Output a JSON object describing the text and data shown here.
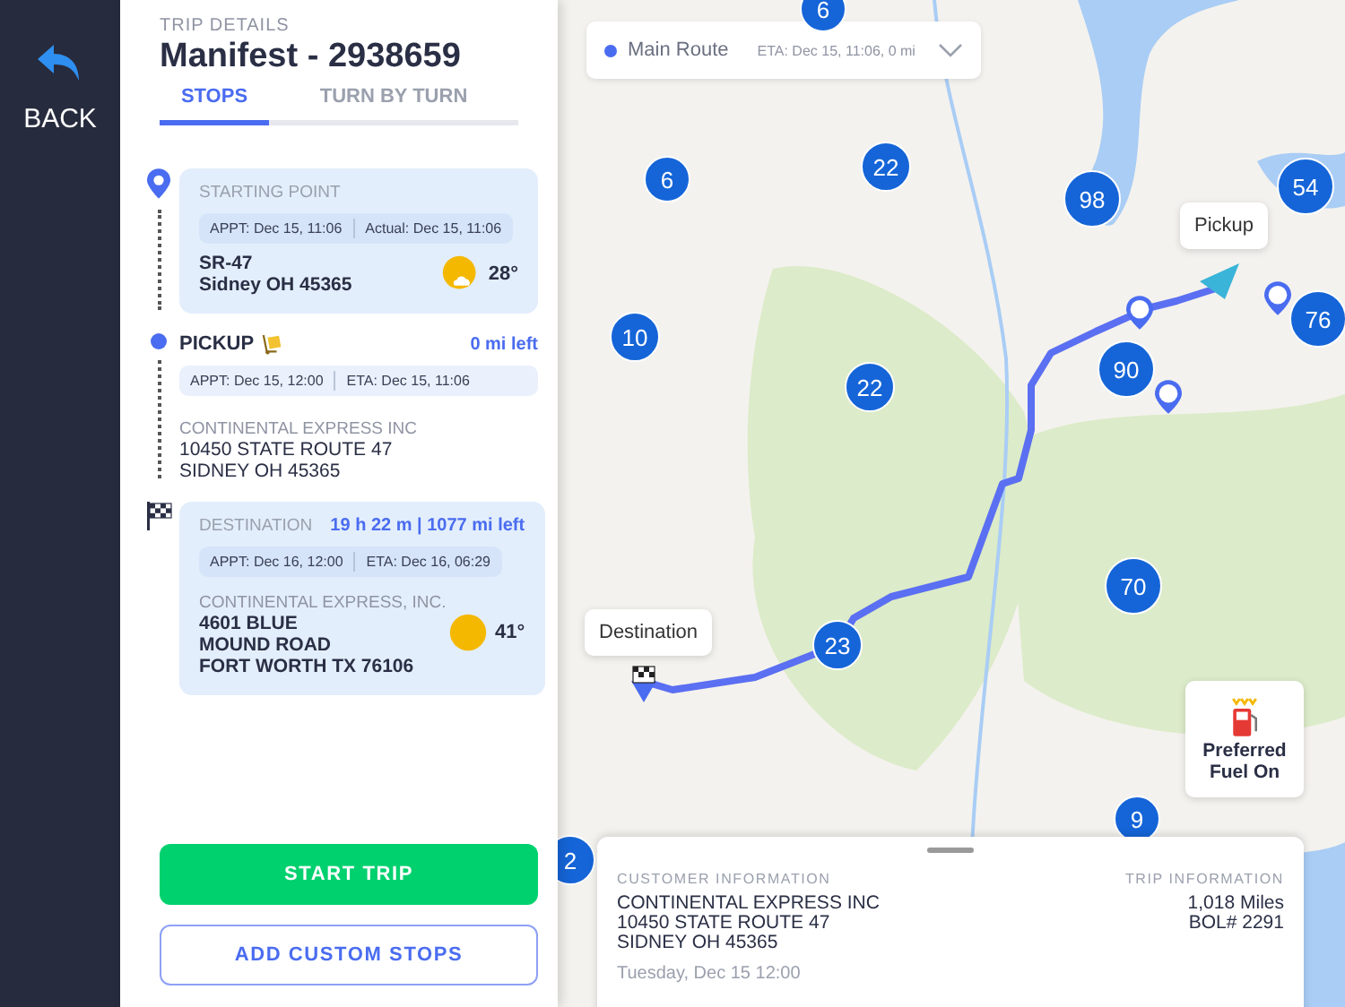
{
  "nav": {
    "back_label": "BACK"
  },
  "trip": {
    "caption": "TRIP DETAILS",
    "title": "Manifest - 2938659"
  },
  "tabs": [
    {
      "label": "STOPS",
      "selected": true
    },
    {
      "label": "TURN BY TURN",
      "selected": false
    }
  ],
  "stops": [
    {
      "kind": "start",
      "label": "STARTING POINT",
      "times": [
        "APPT: Dec 15, 11:06",
        "Actual: Dec 15, 11:06"
      ],
      "address": [
        "SR-47",
        "Sidney OH 45365"
      ],
      "weather": {
        "kind": "partly_cloudy",
        "temperature": "28°"
      }
    },
    {
      "kind": "pickup",
      "label": "PICKUP",
      "distance": "0 mi left",
      "times": [
        "APPT: Dec 15, 12:00",
        "ETA: Dec 15, 11:06"
      ],
      "company": "CONTINENTAL EXPRESS INC",
      "address": [
        "10450 STATE ROUTE 47",
        "SIDNEY OH 45365"
      ]
    },
    {
      "kind": "destination",
      "label": "DESTINATION",
      "distance": "19 h 22 m | 1077 mi left",
      "times": [
        "APPT: Dec 16, 12:00",
        "ETA: Dec 16, 06:29"
      ],
      "company": "CONTINENTAL EXPRESS, INC.",
      "address": [
        "4601 BLUE",
        "MOUND ROAD",
        "FORT WORTH TX 76106"
      ],
      "weather": {
        "kind": "sunny",
        "temperature": "41°"
      }
    }
  ],
  "actions": {
    "primary": "START TRIP",
    "secondary": "ADD CUSTOM STOPS"
  },
  "map": {
    "route_selector": {
      "name": "Main Route",
      "eta": "ETA: Dec 15, 11:06, 0 mi"
    },
    "callouts": [
      "Pickup",
      "Destination"
    ],
    "clusters": [
      "6",
      "6",
      "22",
      "98",
      "54",
      "76",
      "10",
      "22",
      "90",
      "70",
      "23",
      "9",
      "2"
    ],
    "fuel_badge": "Preferred Fuel On"
  },
  "info_card": {
    "customer_heading": "CUSTOMER INFORMATION",
    "customer_lines": [
      "CONTINENTAL EXPRESS INC",
      "10450 STATE ROUTE 47",
      "SIDNEY OH 45365"
    ],
    "date": "Tuesday, Dec 15 12:00",
    "trip_heading": "TRIP INFORMATION",
    "trip_lines": [
      "1,018 Miles",
      "BOL# 2291"
    ]
  }
}
